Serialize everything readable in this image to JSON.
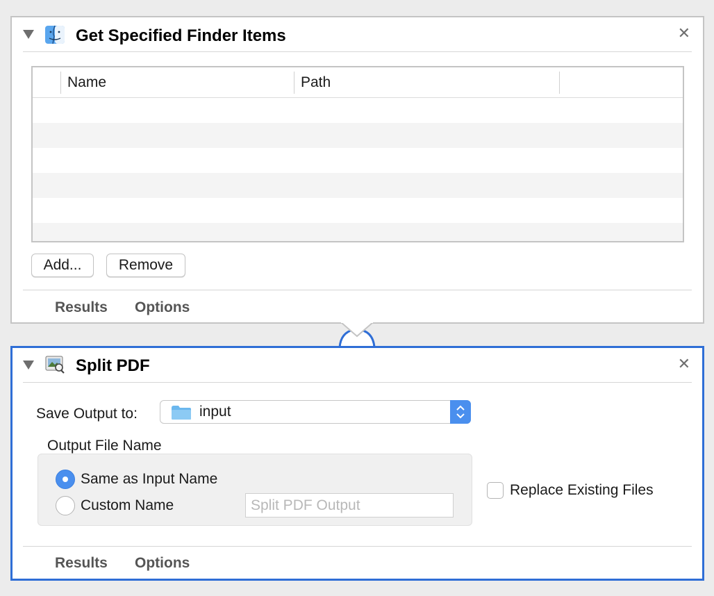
{
  "action1": {
    "title": "Get Specified Finder Items",
    "icon": "finder-icon",
    "columns": [
      "Name",
      "Path"
    ],
    "rows": [],
    "buttons": {
      "add": "Add...",
      "remove": "Remove"
    },
    "footer_tabs": [
      "Results",
      "Options"
    ]
  },
  "action2": {
    "title": "Split PDF",
    "icon": "preview-icon",
    "save_output_label": "Save Output to:",
    "save_output_value": "input",
    "output_file_name_label": "Output File Name",
    "radio_same": "Same as Input Name",
    "radio_custom": "Custom Name",
    "radio_selected": "same",
    "custom_name_placeholder": "Split PDF Output",
    "replace_existing_label": "Replace Existing Files",
    "replace_existing_checked": false,
    "footer_tabs": [
      "Results",
      "Options"
    ]
  },
  "colors": {
    "selected_border": "#2f6ed6",
    "accent": "#4a8fee",
    "folder": "#6bb7ee"
  }
}
